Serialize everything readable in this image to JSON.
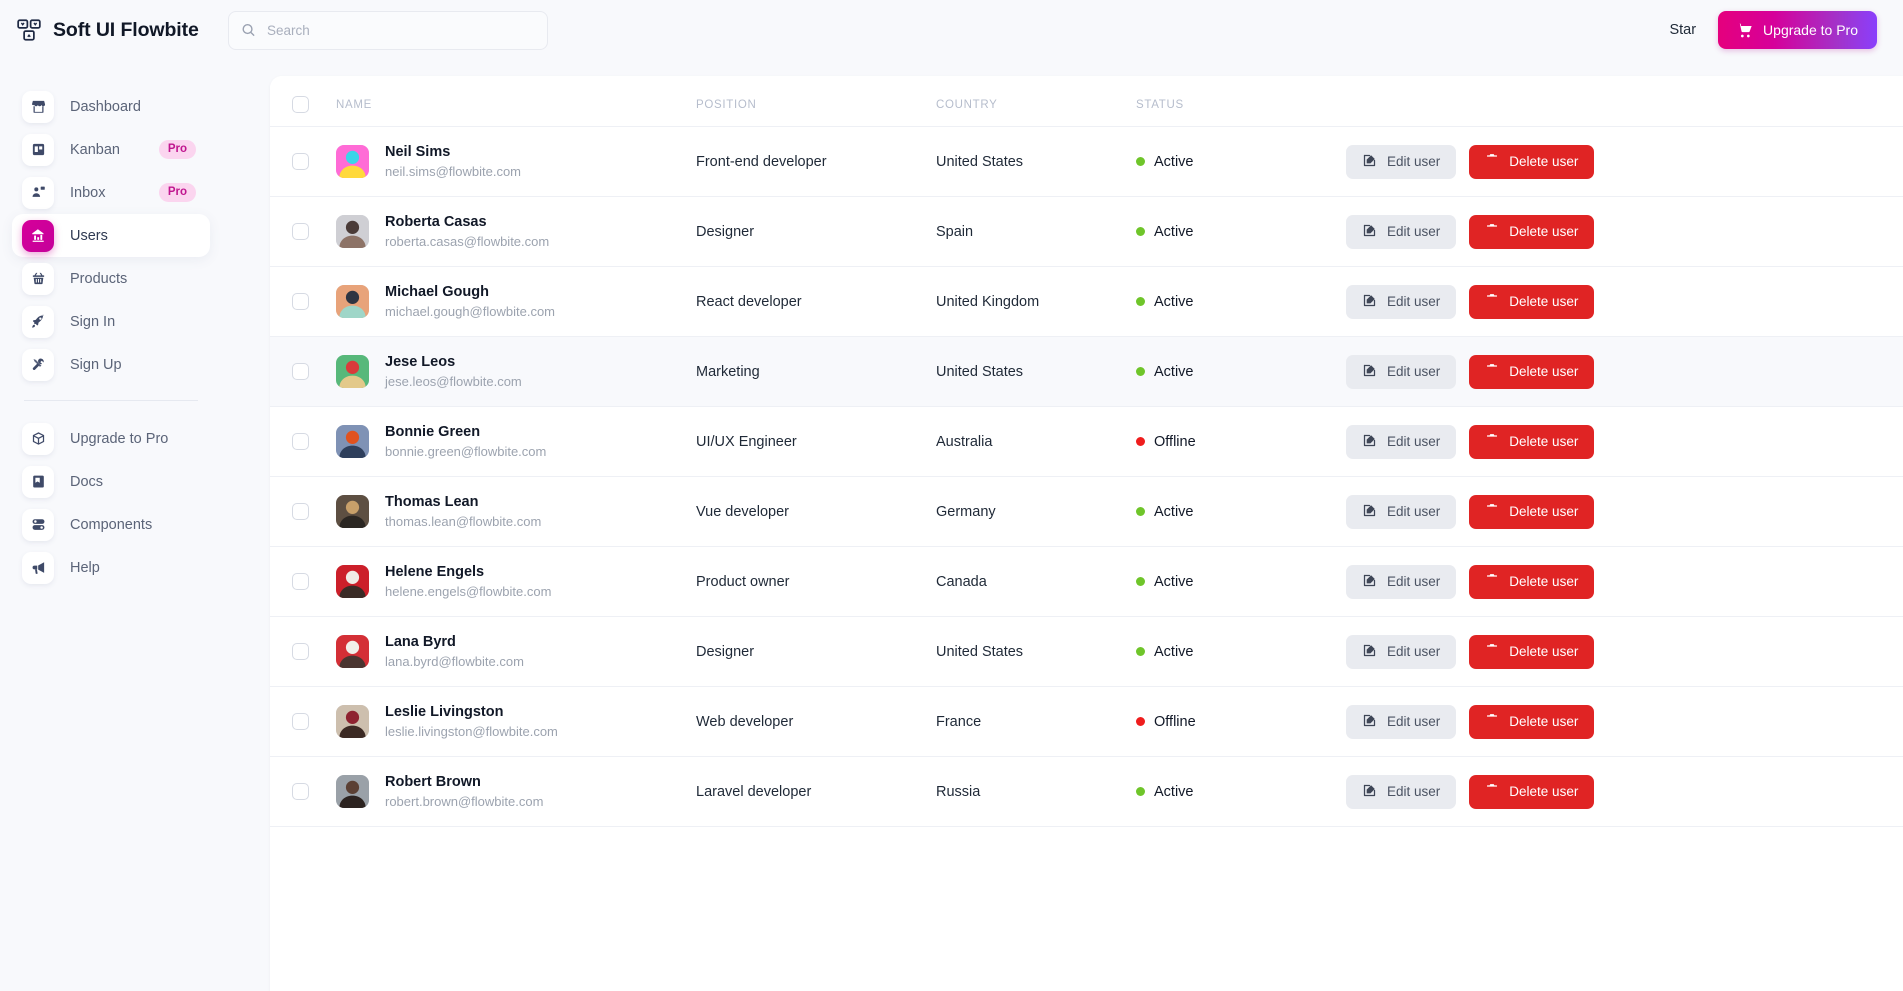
{
  "app": {
    "brand_title": "Soft UI Flowbite",
    "logo_icon": "dashboard-grid-icon"
  },
  "search": {
    "placeholder": "Search",
    "value": "",
    "icon": "search-icon"
  },
  "topbar": {
    "star_label": "Star",
    "upgrade_label": "Upgrade to Pro",
    "upgrade_icon": "shopping-cart-icon",
    "upgrade_gradient_from": "#e5007d",
    "upgrade_gradient_to": "#8a3ffc"
  },
  "sidebar": {
    "items": [
      {
        "label": "Dashboard",
        "icon": "store-icon",
        "badge": "",
        "active": false
      },
      {
        "label": "Kanban",
        "icon": "kanban-board-icon",
        "badge": "Pro",
        "active": false
      },
      {
        "label": "Inbox",
        "icon": "inbox-user-icon",
        "badge": "Pro",
        "active": false
      },
      {
        "label": "Users",
        "icon": "chart-bars-icon",
        "badge": "",
        "active": true
      },
      {
        "label": "Products",
        "icon": "shopping-basket-icon",
        "badge": "",
        "active": false
      },
      {
        "label": "Sign In",
        "icon": "rocket-icon",
        "badge": "",
        "active": false
      },
      {
        "label": "Sign Up",
        "icon": "tools-icon",
        "badge": "",
        "active": false
      }
    ],
    "secondary_items": [
      {
        "label": "Upgrade to Pro",
        "icon": "box-3d-icon"
      },
      {
        "label": "Docs",
        "icon": "book-icon"
      },
      {
        "label": "Components",
        "icon": "components-icon"
      },
      {
        "label": "Help",
        "icon": "megaphone-icon"
      }
    ]
  },
  "table": {
    "columns": [
      "NAME",
      "POSITION",
      "COUNTRY",
      "STATUS",
      ""
    ],
    "select_all_checkbox": false,
    "status_colors": {
      "active": "#6fc52a",
      "offline": "#ef1d1d"
    },
    "actions": {
      "edit_label": "Edit user",
      "edit_icon": "pencil-square-icon",
      "delete_label": "Delete user",
      "delete_icon": "trash-icon"
    },
    "rows": [
      {
        "name": "Neil Sims",
        "email": "neil.sims@flowbite.com",
        "position": "Front-end developer",
        "country": "United States",
        "status": "Active",
        "avatar_colors": [
          "#ff6bd6",
          "#3ad6e8",
          "#ffd93b"
        ],
        "striped": false
      },
      {
        "name": "Roberta Casas",
        "email": "roberta.casas@flowbite.com",
        "position": "Designer",
        "country": "Spain",
        "status": "Active",
        "avatar_colors": [
          "#cfcfd4",
          "#4a3b38",
          "#8d7367"
        ],
        "striped": false
      },
      {
        "name": "Michael Gough",
        "email": "michael.gough@flowbite.com",
        "position": "React developer",
        "country": "United Kingdom",
        "status": "Active",
        "avatar_colors": [
          "#e8a37a",
          "#2f3542",
          "#9fd6c8"
        ],
        "striped": false
      },
      {
        "name": "Jese Leos",
        "email": "jese.leos@flowbite.com",
        "position": "Marketing",
        "country": "United States",
        "status": "Active",
        "avatar_colors": [
          "#57b87a",
          "#d93b3b",
          "#e3c98a"
        ],
        "striped": true
      },
      {
        "name": "Bonnie Green",
        "email": "bonnie.green@flowbite.com",
        "position": "UI/UX Engineer",
        "country": "Australia",
        "status": "Offline",
        "avatar_colors": [
          "#7f92b5",
          "#e0521f",
          "#2e3f5c"
        ],
        "striped": false
      },
      {
        "name": "Thomas Lean",
        "email": "thomas.lean@flowbite.com",
        "position": "Vue developer",
        "country": "Germany",
        "status": "Active",
        "avatar_colors": [
          "#5d4f42",
          "#c8a06a",
          "#2b2723"
        ],
        "striped": false
      },
      {
        "name": "Helene Engels",
        "email": "helene.engels@flowbite.com",
        "position": "Product owner",
        "country": "Canada",
        "status": "Active",
        "avatar_colors": [
          "#cc1f2a",
          "#f0ebe6",
          "#3a2b26"
        ],
        "striped": false
      },
      {
        "name": "Lana Byrd",
        "email": "lana.byrd@flowbite.com",
        "position": "Designer",
        "country": "United States",
        "status": "Active",
        "avatar_colors": [
          "#d42f36",
          "#f2efe9",
          "#4a3530"
        ],
        "striped": false
      },
      {
        "name": "Leslie Livingston",
        "email": "leslie.livingston@flowbite.com",
        "position": "Web developer",
        "country": "France",
        "status": "Offline",
        "avatar_colors": [
          "#cdbfae",
          "#8e2230",
          "#3c2a24"
        ],
        "striped": false
      },
      {
        "name": "Robert Brown",
        "email": "robert.brown@flowbite.com",
        "position": "Laravel developer",
        "country": "Russia",
        "status": "Active",
        "avatar_colors": [
          "#9aa1a8",
          "#5b4034",
          "#2c2320"
        ],
        "striped": false
      }
    ]
  }
}
